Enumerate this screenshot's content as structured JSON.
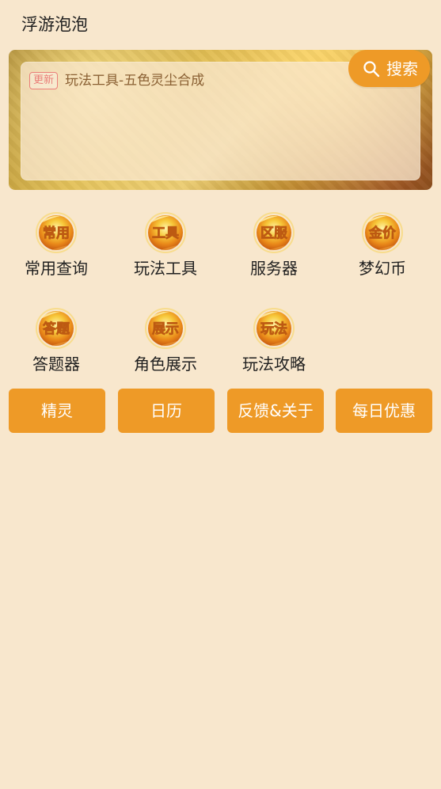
{
  "app": {
    "title": "浮游泡泡"
  },
  "banner": {
    "badge": "更新",
    "notice": "玩法工具-五色灵尘合成",
    "search_label": "搜索"
  },
  "menu": {
    "items": [
      {
        "icon_text": "常用",
        "label": "常用查询"
      },
      {
        "icon_text": "工具",
        "label": "玩法工具"
      },
      {
        "icon_text": "区服",
        "label": "服务器"
      },
      {
        "icon_text": "金价",
        "label": "梦幻币"
      },
      {
        "icon_text": "答题",
        "label": "答题器"
      },
      {
        "icon_text": "展示",
        "label": "角色展示"
      },
      {
        "icon_text": "玩法",
        "label": "玩法攻略"
      }
    ]
  },
  "actions": {
    "items": [
      {
        "label": "精灵"
      },
      {
        "label": "日历"
      },
      {
        "label": "反馈&关于"
      },
      {
        "label": "每日优惠"
      }
    ]
  },
  "colors": {
    "background": "#f8e7cd",
    "accent": "#ee9a27",
    "badge": "#ea7f79",
    "notice_text": "#8a6033"
  },
  "icons": {
    "search": "search-icon",
    "menu_orb": "orb-icon"
  }
}
